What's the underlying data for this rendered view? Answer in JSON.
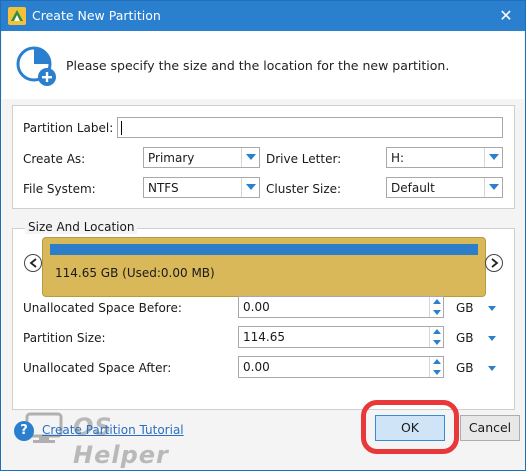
{
  "window": {
    "title": "Create New Partition",
    "close_glyph": "✕"
  },
  "header": {
    "text": "Please specify the size and the location for the new partition.",
    "icon": "pie-plus-icon"
  },
  "form": {
    "partition_label": {
      "label": "Partition Label:",
      "value": ""
    },
    "create_as": {
      "label": "Create As:",
      "value": "Primary"
    },
    "drive_letter": {
      "label": "Drive Letter:",
      "value": "H:"
    },
    "file_system": {
      "label": "File System:",
      "value": "NTFS"
    },
    "cluster_size": {
      "label": "Cluster Size:",
      "value": "Default"
    }
  },
  "size_location": {
    "legend": "Size And Location",
    "disk_caption": "114.65 GB (Used:0.00 MB)",
    "used_fraction": 1.0,
    "unalloc_before": {
      "label": "Unallocated Space Before:",
      "value": "0.00",
      "unit": "GB"
    },
    "partition_size": {
      "label": "Partition Size:",
      "value": "114.65",
      "unit": "GB"
    },
    "unalloc_after": {
      "label": "Unallocated Space After:",
      "value": "0.00",
      "unit": "GB"
    }
  },
  "footer": {
    "help_glyph": "?",
    "tutorial_link": "Create Partition Tutorial",
    "watermark": "OS Helper",
    "ok": "OK",
    "cancel": "Cancel"
  },
  "colors": {
    "accent": "#2a7fce",
    "disk_bar": "#d9b85a",
    "highlight": "#e8383a"
  }
}
